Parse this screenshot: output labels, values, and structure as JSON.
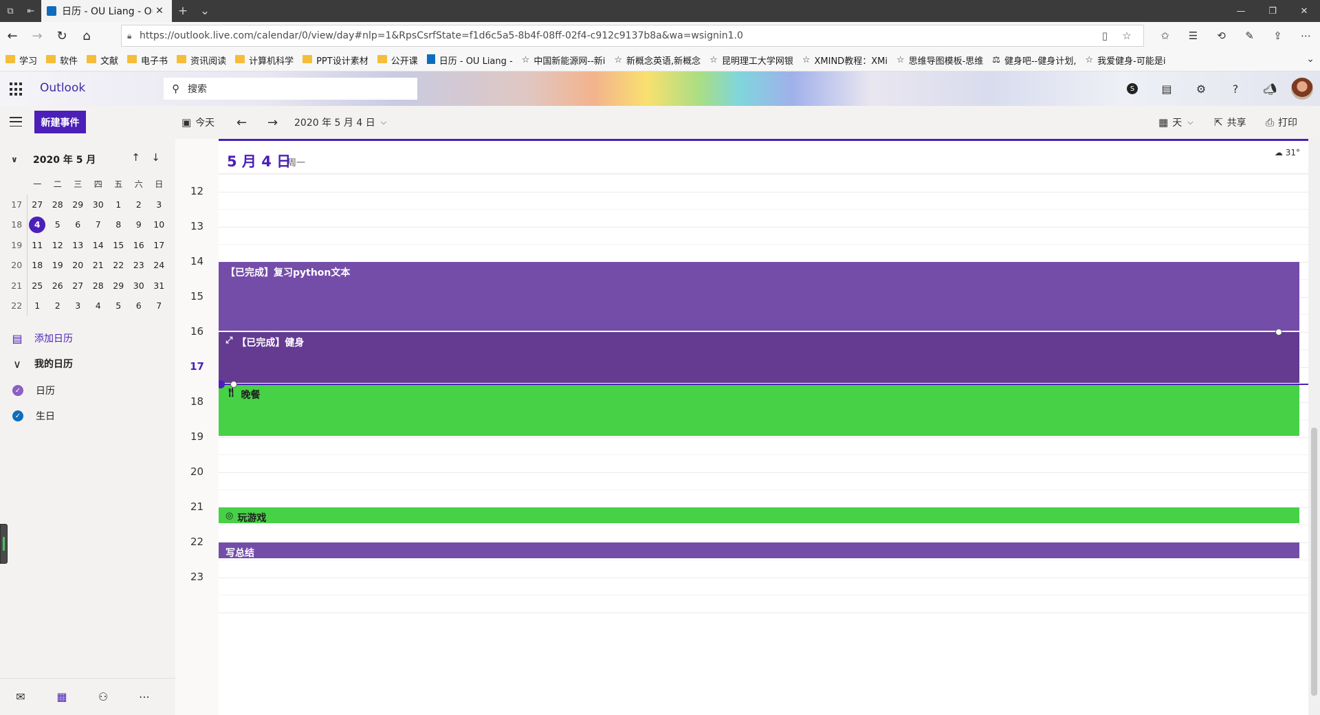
{
  "browser": {
    "tab_title": "日历 - OU Liang - Ou",
    "url": "https://outlook.live.com/calendar/0/view/day#nlp=1&RpsCsrfState=f1d6c5a5-8b4f-08ff-02f4-c912c9137b8a&wa=wsignin1.0",
    "favorites": [
      {
        "icon": "folder",
        "label": "学习"
      },
      {
        "icon": "folder",
        "label": "软件"
      },
      {
        "icon": "folder",
        "label": "文献"
      },
      {
        "icon": "folder",
        "label": "电子书"
      },
      {
        "icon": "folder",
        "label": "资讯阅读"
      },
      {
        "icon": "folder",
        "label": "计算机科学"
      },
      {
        "icon": "folder",
        "label": "PPT设计素材"
      },
      {
        "icon": "folder",
        "label": "公开课"
      },
      {
        "icon": "page",
        "label": "日历 - OU Liang -"
      },
      {
        "icon": "star",
        "label": "中国新能源网--新i"
      },
      {
        "icon": "star",
        "label": "新概念英语,新概念"
      },
      {
        "icon": "star",
        "label": "昆明理工大学网银"
      },
      {
        "icon": "star",
        "label": "XMIND教程：XMi"
      },
      {
        "icon": "star",
        "label": "思维导图模板-思维"
      },
      {
        "icon": "dumbbell",
        "label": "健身吧--健身计划,"
      },
      {
        "icon": "star",
        "label": "我爱健身-可能是i"
      }
    ]
  },
  "header": {
    "brand": "Outlook",
    "search_placeholder": "搜索"
  },
  "toolbar": {
    "new_event": "新建事件",
    "today": "今天",
    "date_label": "2020 年 5 月 4 日",
    "view": "天",
    "share": "共享",
    "print": "打印"
  },
  "mini_calendar": {
    "month_label": "2020 年 5 月",
    "weekdays": [
      "一",
      "二",
      "三",
      "四",
      "五",
      "六",
      "日"
    ],
    "weeks": [
      {
        "week": "17",
        "days": [
          "27",
          "28",
          "29",
          "30",
          "1",
          "2",
          "3"
        ]
      },
      {
        "week": "18",
        "days": [
          "4",
          "5",
          "6",
          "7",
          "8",
          "9",
          "10"
        ]
      },
      {
        "week": "19",
        "days": [
          "11",
          "12",
          "13",
          "14",
          "15",
          "16",
          "17"
        ]
      },
      {
        "week": "20",
        "days": [
          "18",
          "19",
          "20",
          "21",
          "22",
          "23",
          "24"
        ]
      },
      {
        "week": "21",
        "days": [
          "25",
          "26",
          "27",
          "28",
          "29",
          "30",
          "31"
        ]
      },
      {
        "week": "22",
        "days": [
          "1",
          "2",
          "3",
          "4",
          "5",
          "6",
          "7"
        ]
      }
    ],
    "selected_day": "4"
  },
  "sidebar": {
    "add_calendar": "添加日历",
    "my_calendars": "我的日历",
    "calendars": [
      {
        "label": "日历",
        "color": "#8b5fc4"
      },
      {
        "label": "生日",
        "color": "#0f6cbd"
      }
    ]
  },
  "day": {
    "title": "5 月 4 日",
    "weekday": "周一",
    "weather": "31°",
    "hours": [
      "12",
      "13",
      "14",
      "15",
      "16",
      "17",
      "18",
      "19",
      "20",
      "21",
      "22",
      "23"
    ],
    "current_hour": "17",
    "events": [
      {
        "title": "【已完成】复习python文本",
        "color": "#744da9",
        "icon": "",
        "start": 14.0,
        "end": 16.0
      },
      {
        "title": "【已完成】健身",
        "color": "#643b91",
        "icon": "expand-icon",
        "start": 16.0,
        "end": 17.5
      },
      {
        "title": "晚餐",
        "color": "#47d147",
        "icon": "fork-knife-icon",
        "start": 17.5,
        "end": 19.0
      },
      {
        "title": "玩游戏",
        "color": "#47d147",
        "icon": "target-icon",
        "start": 21.0,
        "end": 21.5
      },
      {
        "title": "写总结",
        "color": "#744da9",
        "icon": "",
        "start": 22.0,
        "end": 22.5
      }
    ],
    "now_time": 17.5
  }
}
